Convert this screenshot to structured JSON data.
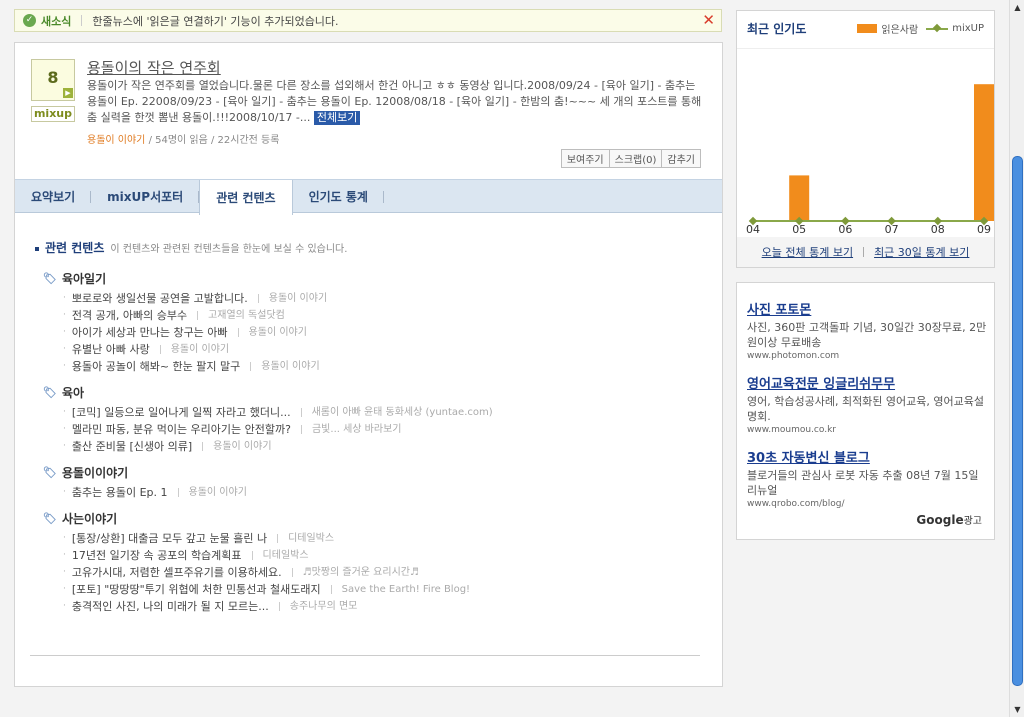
{
  "notice": {
    "badge": "새소식",
    "message": "한줄뉴스에 '읽은글 연결하기' 기능이 추가되었습니다.",
    "close_icon": "close-icon"
  },
  "post": {
    "mixup_count": "8",
    "mixup_logo": "mixup",
    "title": "용돌이의 작은 연주회",
    "body": "용돌이가 작은 연주회를 열었습니다.물론 다른 장소를 섭외해서 한건 아니고 ㅎㅎ 동영상 입니다.2008/09/24 - [육아 일기] - 춤추는 용돌이 Ep. 22008/09/23 - [육아 일기] - 춤추는 용돌이 Ep. 12008/08/18 - [육아 일기] - 한밤의 춤!~~~ 세 개의 포스트를 통해 춤 실력을 한껏 뽐낸 용돌이.!!!2008/10/17 -...",
    "more_label": "전체보기",
    "cafe": "용돌이 이야기",
    "meta": " / 54명이 읽음 / 22시간전 등록",
    "actions": [
      "보여주기",
      "스크랩(0)",
      "감추기"
    ]
  },
  "tabs": [
    {
      "label": "요약보기",
      "active": false
    },
    {
      "label": "mixUP서포터",
      "active": false
    },
    {
      "label": "관련 컨텐츠",
      "active": true
    },
    {
      "label": "인기도 통계",
      "active": false
    }
  ],
  "related": {
    "heading": "관련 컨텐츠",
    "description": "이 컨텐츠와 관련된 컨텐츠들을 한눈에 보실 수 있습니다.",
    "categories": [
      {
        "title": "육아일기",
        "items": [
          {
            "text": "뽀로로와 생일선물 공연을 고발합니다.",
            "source": "용돌이 이야기"
          },
          {
            "text": "전격 공개, 아빠의 승부수",
            "source": "고재열의 독설닷컴"
          },
          {
            "text": "아이가 세상과 만나는 창구는 아빠",
            "source": "용돌이 이야기"
          },
          {
            "text": "유별난 아빠 사랑",
            "source": "용돌이 이야기"
          },
          {
            "text": "용돌아 공놀이 해봐~ 한눈 팔지 말구",
            "source": "용돌이 이야기"
          }
        ]
      },
      {
        "title": "육아",
        "items": [
          {
            "text": "[코믹] 일등으로 일어나게 일찍 자라고 했더니...",
            "source": "새롬이 아빠 윤태 동화세상 (yuntae.com)"
          },
          {
            "text": "멜라민 파동, 분유 먹이는 우리아기는 안전할까?",
            "source": "금빛... 세상 바라보기"
          },
          {
            "text": "출산 준비물 [신생아 의류]",
            "source": "용돌이 이야기"
          }
        ]
      },
      {
        "title": "용돌이이야기",
        "items": [
          {
            "text": "춤추는 용돌이 Ep. 1",
            "source": "용돌이 이야기"
          }
        ]
      },
      {
        "title": "사는이야기",
        "items": [
          {
            "text": "[통장/상환] 대출금 모두 갚고 눈물 흘린 나",
            "source": "디테일박스"
          },
          {
            "text": "17년전 일기장 속 공포의 학습계획표",
            "source": "디테일박스"
          },
          {
            "text": "고유가시대, 저렴한 셀프주유기를 이용하세요.",
            "source": "♬맛짱의 즐거운 요리시간♬"
          },
          {
            "text": "[포토] \"땅땅땅\"투기 위협에 처한 민통선과 철새도래지",
            "source": "Save the Earth! Fire Blog!"
          },
          {
            "text": "충격적인 사진, 나의 미래가 될 지 모르는...",
            "source": "송주나무의 면모"
          }
        ]
      }
    ]
  },
  "popularity": {
    "title": "최근 인기도",
    "legend_reads": "읽은사람",
    "legend_mixup": "mixUP",
    "link_today": "오늘 전체 통계 보기",
    "link_30days": "최근 30일 통계 보기"
  },
  "chart_data": {
    "type": "bar",
    "categories": [
      "04",
      "05",
      "06",
      "07",
      "08",
      "09"
    ],
    "series": [
      {
        "name": "읽은사람",
        "values": [
          0,
          12,
          0,
          0,
          0,
          36
        ],
        "color": "#f18c1c"
      },
      {
        "name": "mixUP",
        "values": [
          0,
          0,
          0,
          0,
          0,
          0
        ],
        "color": "#8aa84a",
        "type": "line"
      }
    ],
    "ylim": [
      0,
      40
    ],
    "grid": false,
    "legend": "top-right"
  },
  "ads": [
    {
      "title": "사진 포토몬",
      "desc": "사진, 360판 고객돌파 기념, 30일간 30장무료, 2만원이상 무료배송",
      "url": "www.photomon.com"
    },
    {
      "title": "영어교육전문 잉글리쉬무무",
      "desc": "영어, 학습성공사례, 최적화된 영어교육, 영어교육설명회.",
      "url": "www.moumou.co.kr"
    },
    {
      "title": "30초 자동변신 블로그",
      "desc": "블로거들의 관심사 로봇 자동 추출 08년 7월 15일 리뉴얼",
      "url": "www.qrobo.com/blog/"
    }
  ],
  "google": {
    "brand": "Google",
    "suffix": "광고"
  }
}
